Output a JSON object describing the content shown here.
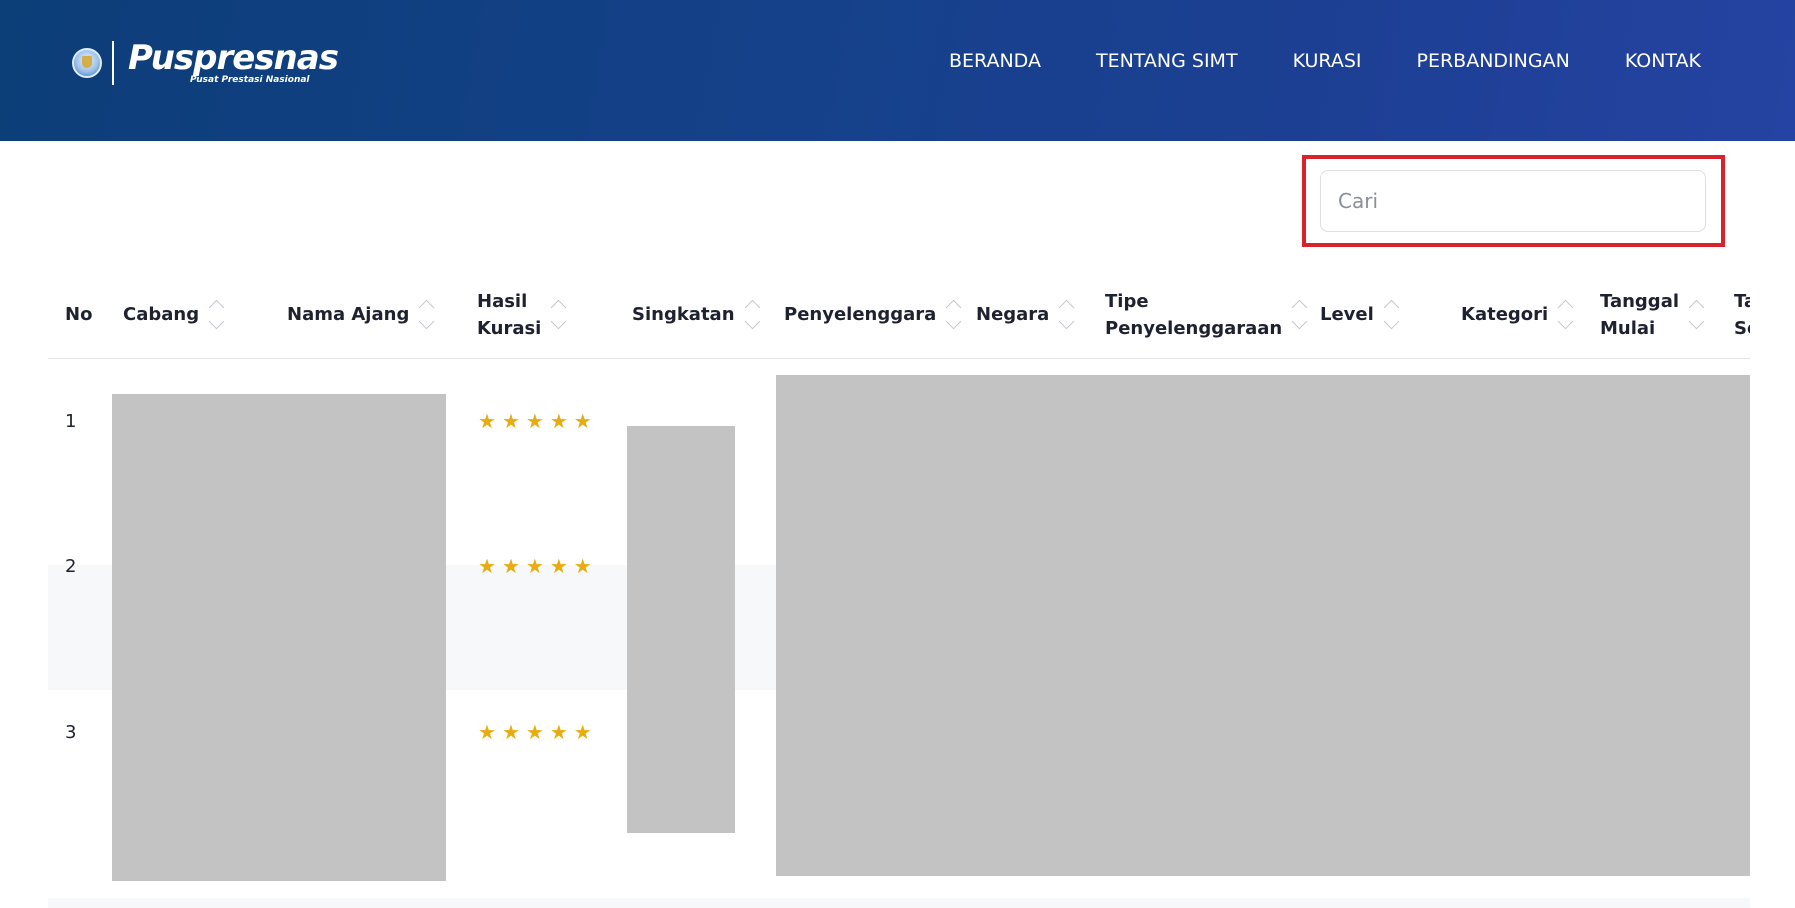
{
  "header": {
    "brand_name": "Puspresnas",
    "brand_sub": "Pusat Prestasi Nasional",
    "nav": [
      "BERANDA",
      "TENTANG SIMT",
      "KURASI",
      "PERBANDINGAN",
      "KONTAK"
    ]
  },
  "search": {
    "placeholder": "Cari",
    "value": ""
  },
  "table": {
    "columns": [
      "No",
      "Cabang",
      "Nama Ajang",
      "Hasil\nKurasi",
      "Singkatan",
      "Penyelenggara",
      "Negara",
      "Tipe\nPenyelenggaraan",
      "Level",
      "Kategori",
      "Tanggal\nMulai",
      "Ta\nSe"
    ],
    "rows": [
      {
        "no": "1",
        "rating": 5
      },
      {
        "no": "2",
        "rating": 5
      },
      {
        "no": "3",
        "rating": 5
      }
    ],
    "star_color": "#e7ac10",
    "highlight_color": "#d8232a"
  }
}
